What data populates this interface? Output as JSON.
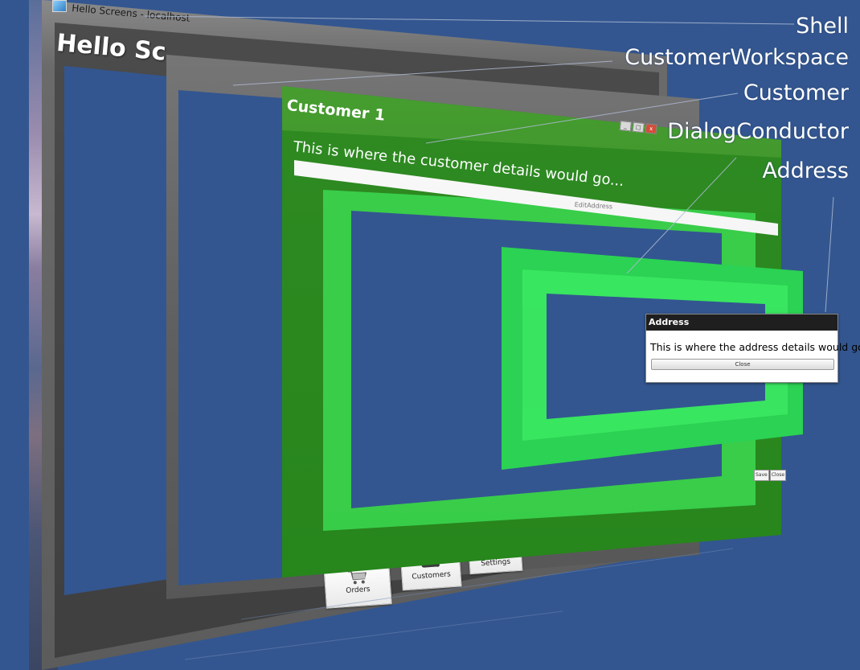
{
  "shell": {
    "window_title": "Hello Screens - localhost",
    "title": "Hello Sc"
  },
  "workspace": {
    "tabs": [
      {
        "label": "Orders",
        "icon": "cart-icon"
      },
      {
        "label": "Customers",
        "icon": "cloud-icon"
      },
      {
        "label": "Settings",
        "icon": "document-icon"
      }
    ]
  },
  "customer": {
    "title": "Customer 1",
    "details_text": "This is where the customer details would go...",
    "edit_address_label": "EditAddress",
    "save_label": "Save",
    "close_label": "Close",
    "window_buttons": [
      "_",
      "□",
      "x"
    ]
  },
  "address": {
    "title": "Address",
    "details_text": "This is where the address details would go...",
    "close_label": "Close"
  },
  "labels": {
    "shell": "Shell",
    "customer_workspace": "CustomerWorkspace",
    "customer": "Customer",
    "dialog_conductor": "DialogConductor",
    "address": "Address"
  },
  "colors": {
    "background": "#335690",
    "customer_green": "#2f8a22",
    "dialog_green": "#2bd253",
    "address_titlebar": "#1f1f1f"
  }
}
